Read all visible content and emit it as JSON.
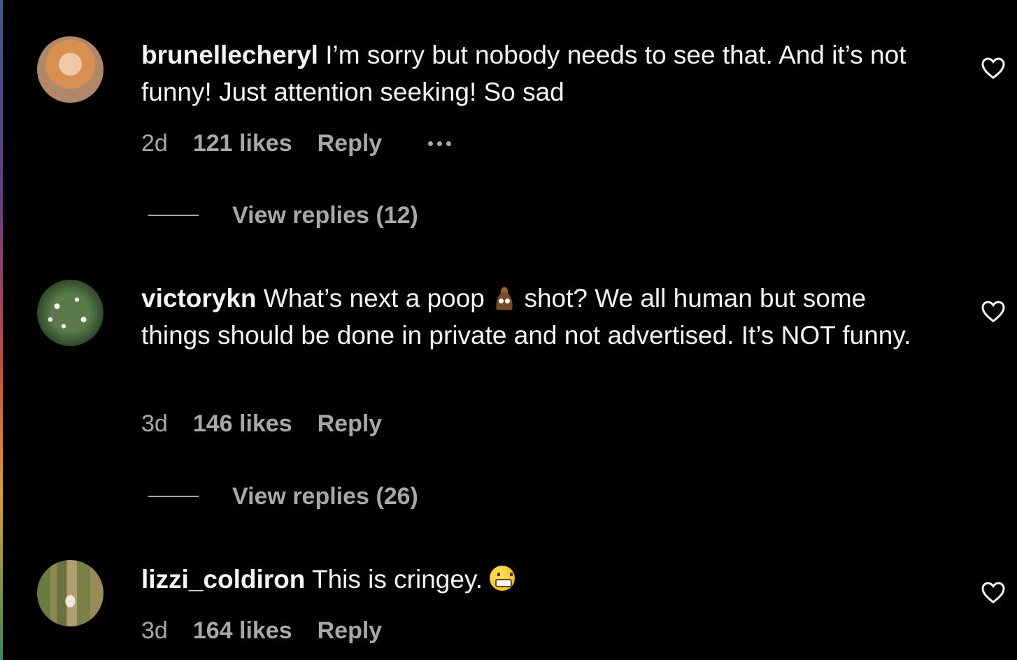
{
  "comments": [
    {
      "username": "brunellecheryl",
      "text": "I’m sorry but nobody needs to see that. And it’s not funny! Just attention seeking! So sad",
      "time": "2d",
      "likes": "121 likes",
      "reply": "Reply",
      "view_replies": "View replies (12)"
    },
    {
      "username": "victorykn",
      "text_before_emoji": "What’s next a poop",
      "text_after_emoji": "shot? We all human but some things should be done in private and not advertised. It’s NOT funny.",
      "time": "3d",
      "likes": "146 likes",
      "reply": "Reply",
      "view_replies": "View replies (26)"
    },
    {
      "username": "lizzi_coldiron",
      "text": "This is cringey.",
      "time": "3d",
      "likes": "164 likes",
      "reply": "Reply"
    }
  ],
  "icons": {
    "like": "heart-outline-icon",
    "more": "more-horizontal-icon",
    "emoji_1": "pile-of-poo-emoji",
    "emoji_2": "grimacing-face-emoji"
  },
  "colors": {
    "background": "#000000",
    "primary_text": "#f5f5f5",
    "secondary_text": "#a8a8a8"
  }
}
